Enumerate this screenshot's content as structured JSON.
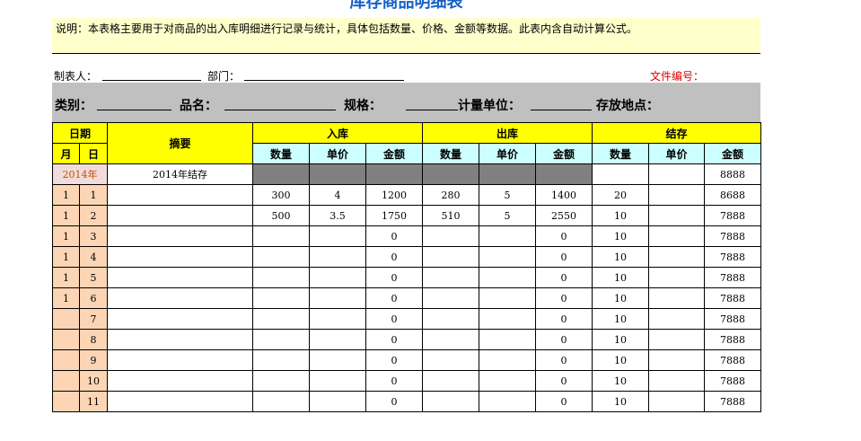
{
  "title": "库存商品明细表",
  "description": "说明：本表格主要用于对商品的出入库明细进行记录与统计，具体包括数量、价格、金额等数据。此表内含自动计算公式。",
  "meta": {
    "maker_label": "制表人：",
    "dept_label": "部门：",
    "file_no_label": "文件编号："
  },
  "category_row": {
    "category_label": "类别：",
    "name_label": "品名：",
    "spec_label": "规格：",
    "unit_label": "计量单位：",
    "location_label": "存放地点："
  },
  "headers": {
    "date": "日期",
    "month": "月",
    "day": "日",
    "summary": "摘要",
    "in": "入库",
    "out": "出库",
    "balance": "结存",
    "qty": "数量",
    "price": "单价",
    "amount": "金额"
  },
  "carry_row": {
    "year": "2014年",
    "summary": "2014年结存",
    "bal_amount": "8888"
  },
  "rows": [
    {
      "m": "1",
      "d": "1",
      "in_qty": "300",
      "in_price": "4",
      "in_amt": "1200",
      "out_qty": "280",
      "out_price": "5",
      "out_amt": "1400",
      "bal_qty": "20",
      "bal_amt": "8688"
    },
    {
      "m": "1",
      "d": "2",
      "in_qty": "500",
      "in_price": "3.5",
      "in_amt": "1750",
      "out_qty": "510",
      "out_price": "5",
      "out_amt": "2550",
      "bal_qty": "10",
      "bal_amt": "7888"
    },
    {
      "m": "1",
      "d": "3",
      "in_qty": "",
      "in_price": "",
      "in_amt": "0",
      "out_qty": "",
      "out_price": "",
      "out_amt": "0",
      "bal_qty": "10",
      "bal_amt": "7888"
    },
    {
      "m": "1",
      "d": "4",
      "in_qty": "",
      "in_price": "",
      "in_amt": "0",
      "out_qty": "",
      "out_price": "",
      "out_amt": "0",
      "bal_qty": "10",
      "bal_amt": "7888"
    },
    {
      "m": "1",
      "d": "5",
      "in_qty": "",
      "in_price": "",
      "in_amt": "0",
      "out_qty": "",
      "out_price": "",
      "out_amt": "0",
      "bal_qty": "10",
      "bal_amt": "7888"
    },
    {
      "m": "1",
      "d": "6",
      "in_qty": "",
      "in_price": "",
      "in_amt": "0",
      "out_qty": "",
      "out_price": "",
      "out_amt": "0",
      "bal_qty": "10",
      "bal_amt": "7888"
    },
    {
      "m": "",
      "d": "7",
      "in_qty": "",
      "in_price": "",
      "in_amt": "0",
      "out_qty": "",
      "out_price": "",
      "out_amt": "0",
      "bal_qty": "10",
      "bal_amt": "7888"
    },
    {
      "m": "",
      "d": "8",
      "in_qty": "",
      "in_price": "",
      "in_amt": "0",
      "out_qty": "",
      "out_price": "",
      "out_amt": "0",
      "bal_qty": "10",
      "bal_amt": "7888"
    },
    {
      "m": "",
      "d": "9",
      "in_qty": "",
      "in_price": "",
      "in_amt": "0",
      "out_qty": "",
      "out_price": "",
      "out_amt": "0",
      "bal_qty": "10",
      "bal_amt": "7888"
    },
    {
      "m": "",
      "d": "10",
      "in_qty": "",
      "in_price": "",
      "in_amt": "0",
      "out_qty": "",
      "out_price": "",
      "out_amt": "0",
      "bal_qty": "10",
      "bal_amt": "7888"
    },
    {
      "m": "",
      "d": "11",
      "in_qty": "",
      "in_price": "",
      "in_amt": "0",
      "out_qty": "",
      "out_price": "",
      "out_amt": "0",
      "bal_qty": "10",
      "bal_amt": "7888"
    }
  ]
}
